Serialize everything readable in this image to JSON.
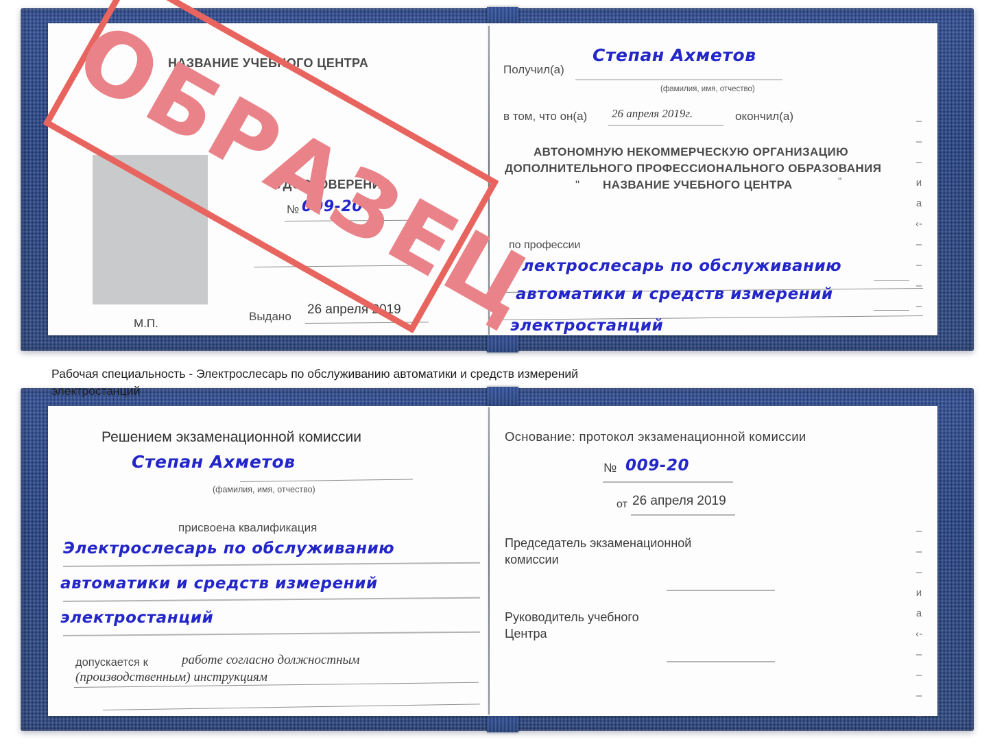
{
  "caption": {
    "line1": "Рабочая специальность - Электрослесарь по обслуживанию автоматики и средств измерений",
    "line2": "электростанций"
  },
  "stamp": {
    "text": "ОБРАЗЕЦ",
    "border_color": "#e8645e",
    "text_color": "#ea8389"
  },
  "colors": {
    "cover_blue": "#24417f",
    "handwriting_blue": "#2326c8",
    "photo_placeholder_gray": "#c9cacb",
    "page_white": "#fdfdfd"
  },
  "certificate_top": {
    "left_page": {
      "org_title": "НАЗВАНИЕ УЧЕБНОГО ЦЕНТРА",
      "doc_type": "УДОСТОВЕРЕНИЕ",
      "number_label": "№",
      "number_value": "009-20",
      "issued_label": "Выдано",
      "issued_value": "26 апреля 2019",
      "seal_label": "М.П.",
      "photo_placeholder": ""
    },
    "right_page": {
      "received_label": "Получил(а)",
      "received_value": "Степан Ахметов",
      "fio_hint": "(фамилия, имя, отчество)",
      "that_he_label": "в том, что он(а)",
      "completion_date": "26 апреля 2019г.",
      "finished_label": "окончил(а)",
      "org_line1": "АВТОНОМНУЮ НЕКОММЕРЧЕСКУЮ ОРГАНИЗАЦИЮ",
      "org_line2": "ДОПОЛНИТЕЛЬНОГО ПРОФЕССИОНАЛЬНОГО ОБРАЗОВАНИЯ",
      "org_quote_open": "\"",
      "org_line3": "НАЗВАНИЕ УЧЕБНОГО ЦЕНТРА",
      "org_quote_close": "\"",
      "profession_label": "по профессии",
      "profession_line1": "Электрослесарь по обслуживанию",
      "profession_line2": "автоматики и средств измерений",
      "profession_line3": "электростанций"
    }
  },
  "certificate_bottom": {
    "left_page": {
      "commission_decision": "Решением экзаменационной комиссии",
      "name_value": "Степан Ахметов",
      "fio_hint": "(фамилия, имя, отчество)",
      "qualification_label": "присвоена квалификация",
      "qualification_line1": "Электрослесарь по обслуживанию",
      "qualification_line2": "автоматики и средств измерений",
      "qualification_line3": "электростанций",
      "admitted_label": "допускается к",
      "admitted_line1": "работе согласно должностным",
      "admitted_line2": "(производственным) инструкциям"
    },
    "right_page": {
      "basis_label": "Основание: протокол экзаменационной комиссии",
      "protocol_number_label": "№",
      "protocol_number_value": "009-20",
      "protocol_date_label": "от",
      "protocol_date_value": "26 апреля 2019",
      "chairman_line1": "Председатель экзаменационной",
      "chairman_line2": "комиссии",
      "chairman_signature": "",
      "head_line1": "Руководитель учебного",
      "head_line2": "Центра",
      "head_signature": ""
    }
  },
  "edge_fragments": {
    "top": [
      "–",
      "–",
      "–",
      "и",
      "а",
      "‹-",
      "–",
      "–",
      "–",
      "–"
    ],
    "bottom": [
      "–",
      "–",
      "–",
      "и",
      "а",
      "‹-",
      "–",
      "–",
      "–",
      "–"
    ]
  }
}
